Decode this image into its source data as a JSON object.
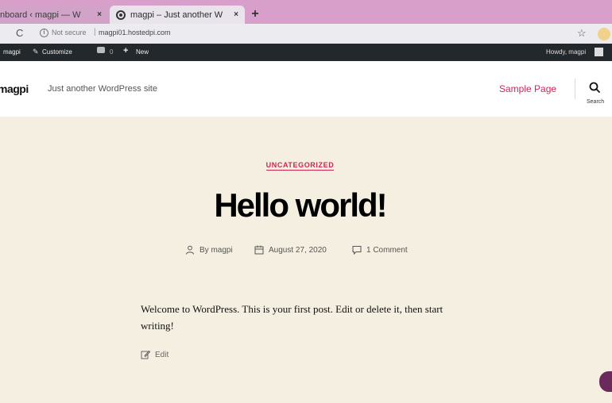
{
  "browser": {
    "tabs": [
      {
        "title": "nboard ‹ magpi — W",
        "active": false
      },
      {
        "title": "magpi – Just another W",
        "active": true
      }
    ],
    "new_tab": "+",
    "close_glyph": "×",
    "reload_glyph": "C",
    "security_text": "Not secure",
    "separator": "|",
    "url": "magpi01.hostedpi.com",
    "bookmark_glyph": "☆"
  },
  "admin_bar": {
    "site_name": "magpi",
    "customize": "Customize",
    "comment_count": "0",
    "plus": "+",
    "new": "New",
    "greeting": "Howdy, magpi"
  },
  "site": {
    "title": "magpi",
    "description": "Just another WordPress site",
    "nav": [
      "Sample Page"
    ],
    "search_label": "Search"
  },
  "post": {
    "category": "UNCATEGORIZED",
    "title": "Hello world!",
    "author": "By magpi",
    "date": "August 27, 2020",
    "comments": "1 Comment",
    "body": "Welcome to WordPress. This is your first post. Edit or delete it, then start writing!",
    "edit": "Edit"
  },
  "colors": {
    "accent": "#cd2653",
    "content_bg": "#f4efe0",
    "admin_bar": "#23282d",
    "frame": "#d79fca"
  }
}
